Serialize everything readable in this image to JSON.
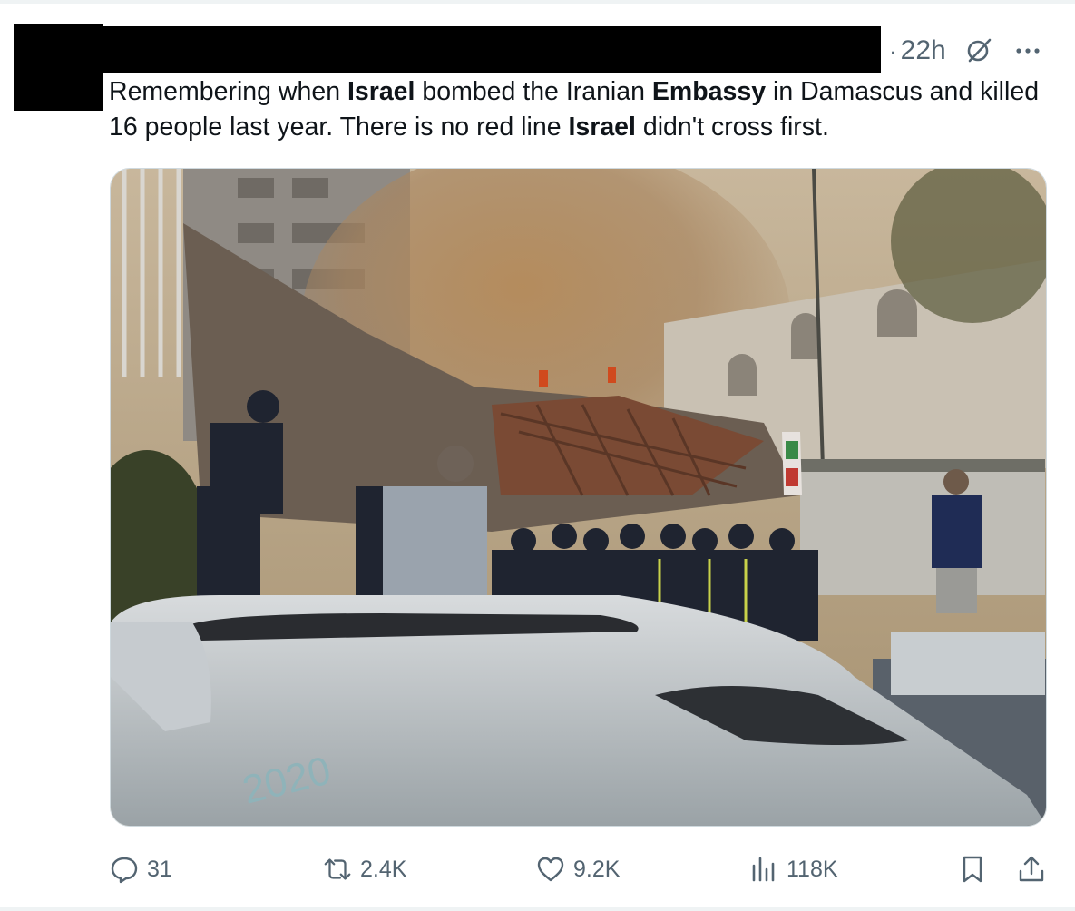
{
  "tweet": {
    "time_separator": "·",
    "timestamp": "22h",
    "text_segments": [
      {
        "text": "Remembering when ",
        "bold": false
      },
      {
        "text": "Israel",
        "bold": true
      },
      {
        "text": " bombed the Iranian ",
        "bold": false
      },
      {
        "text": "Embassy",
        "bold": true
      },
      {
        "text": " in Damascus and killed 16 people last year. There is no red line ",
        "bold": false
      },
      {
        "text": "Israel",
        "bold": true
      },
      {
        "text": " didn't cross first.",
        "bold": false
      }
    ]
  },
  "media": {
    "vehicle_plate_text": "2020"
  },
  "actions": {
    "replies": "31",
    "reposts": "2.4K",
    "likes": "9.2K",
    "views": "118K"
  },
  "icons": {
    "grok": "grok-icon",
    "more": "more-icon",
    "reply": "reply-icon",
    "repost": "repost-icon",
    "like": "heart-icon",
    "views": "views-chart-icon",
    "bookmark": "bookmark-icon",
    "share": "share-icon"
  },
  "colors": {
    "text": "#0f1419",
    "secondary": "#536471",
    "border": "#cfd9de"
  }
}
